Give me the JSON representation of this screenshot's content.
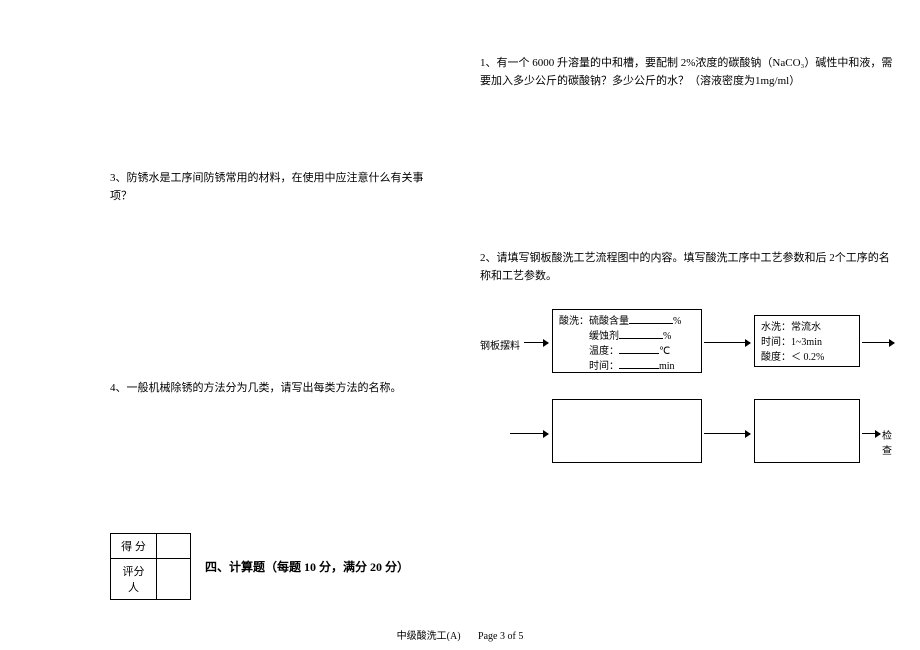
{
  "left": {
    "q3": "3、防锈水是工序间防锈常用的材料，在使用中应注意什么有关事项？",
    "q4": "4、一般机械除锈的方法分为几类，请写出每类方法的名称。",
    "score_rows": [
      "得  分",
      "评分人"
    ],
    "section4": "四、计算题（每题 10 分，满分 20 分）"
  },
  "right": {
    "q1": "1、有一个 6000 升溶量的中和槽，要配制 2%浓度的碳酸钠（NaCO₃）碱性中和液，需要加入多少公斤的碳酸钠？多少公斤的水？（溶液密度为1mg/ml）",
    "q2": "2、请填写钢板酸洗工艺流程图中的内容。填写酸洗工序中工艺参数和后 2个工序的名称和工艺参数。"
  },
  "diagram": {
    "input_label": "钢板摆料",
    "box_acid": {
      "l1a": "酸洗：硫酸含量",
      "l1b": "%",
      "l2a": "缓蚀剂",
      "l2b": "%",
      "l3a": "温度：",
      "l3b": "℃",
      "l4a": "时间：",
      "l4b": "min"
    },
    "box_wash": {
      "l1": "水洗：常流水",
      "l2": "时间：1~3min",
      "l3": "酸度：＜ 0.2%"
    },
    "output_label": "检查"
  },
  "footer": {
    "left": "中级酸洗工(A)",
    "right": "Page 3 of 5"
  }
}
